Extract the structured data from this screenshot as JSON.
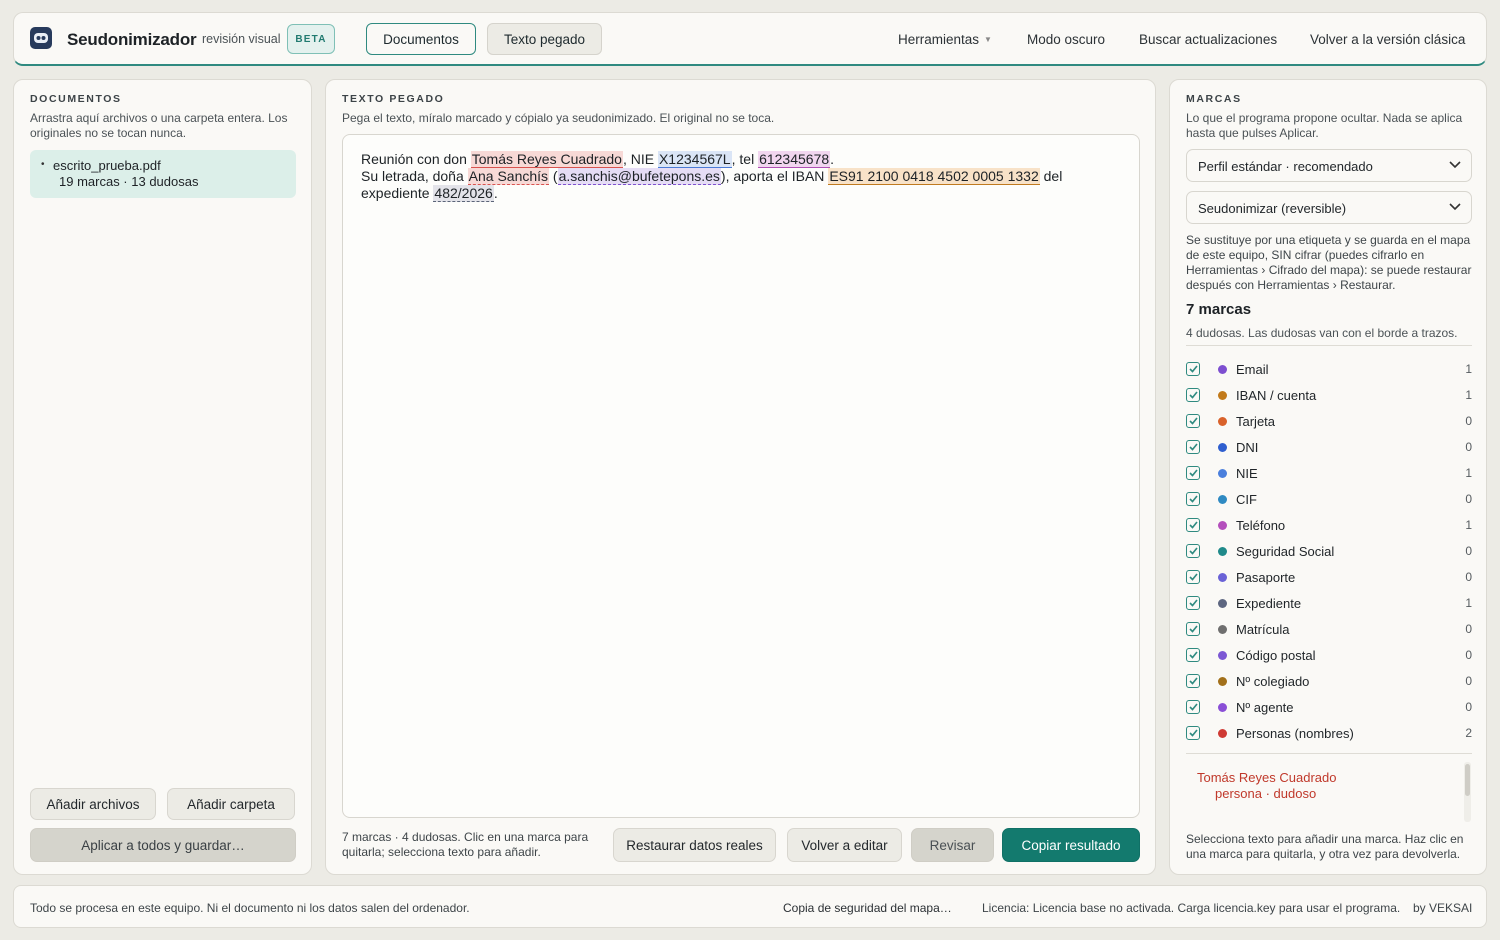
{
  "header": {
    "app_title": "Seudonimizador",
    "subtitle": "revisión visual",
    "badge": "BETA",
    "tabs": [
      {
        "label": "Documentos",
        "active": true
      },
      {
        "label": "Texto pegado",
        "active": false
      }
    ],
    "nav": {
      "tools": "Herramientas",
      "dark_mode": "Modo oscuro",
      "updates": "Buscar actualizaciones",
      "classic": "Volver a la versión clásica"
    }
  },
  "documents": {
    "title": "DOCUMENTOS",
    "description": "Arrastra aquí archivos o una carpeta entera. Los originales no se tocan nunca.",
    "items": [
      {
        "name": "escrito_prueba.pdf",
        "meta": "19 marcas · 13 dudosas"
      }
    ],
    "add_files": "Añadir archivos",
    "add_folder": "Añadir carpeta",
    "apply_all": "Aplicar a todos y guardar…"
  },
  "pasted": {
    "title": "TEXTO PEGADO",
    "description": "Pega el texto, míralo marcado y cópialo ya seudonimizado. El original no se toca.",
    "text": {
      "t1": "Reunión con don ",
      "m1": "Tomás Reyes Cuadrado",
      "t2": ", NIE ",
      "m2": "X1234567L",
      "t3": ", tel ",
      "m3": "612345678",
      "t4": ".",
      "t5": "Su letrada, doña ",
      "m4": "Ana Sanchís",
      "t6": " (",
      "m5": "a.sanchis@bufetepons.es",
      "t7": "), aporta el IBAN ",
      "m6": "ES91 2100 0418 4502 0005 1332",
      "t8": " del expediente ",
      "m7": "482/2026",
      "t9": "."
    },
    "status": "7 marcas · 4 dudosas. Clic en una marca para quitarla; selecciona texto para añadir.",
    "buttons": {
      "restore": "Restaurar datos reales",
      "back": "Volver a editar",
      "review": "Revisar",
      "copy": "Copiar resultado"
    }
  },
  "marks": {
    "title": "MARCAS",
    "description": "Lo que el programa propone ocultar. Nada se aplica hasta que pulses Aplicar.",
    "profile_select": "Perfil estándar · recomendado",
    "mode_select": "Seudonimizar (reversible)",
    "mode_description": "Se sustituye por una etiqueta y se guarda en el mapa de este equipo, SIN cifrar (puedes cifrarlo en Herramientas › Cifrado del mapa): se puede restaurar después con Herramientas › Restaurar.",
    "count_title": "7 marcas",
    "count_description": "4 dudosas. Las dudosas van con el borde a trazos.",
    "categories": [
      {
        "label": "Email",
        "count": "1",
        "color": "#7d4fd0",
        "checked": true
      },
      {
        "label": "IBAN / cuenta",
        "count": "1",
        "color": "#c27a1a",
        "checked": true
      },
      {
        "label": "Tarjeta",
        "count": "0",
        "color": "#d9622b",
        "checked": true
      },
      {
        "label": "DNI",
        "count": "0",
        "color": "#2f5fcf",
        "checked": true
      },
      {
        "label": "NIE",
        "count": "1",
        "color": "#4a7fdc",
        "checked": true
      },
      {
        "label": "CIF",
        "count": "0",
        "color": "#2f8ac2",
        "checked": true
      },
      {
        "label": "Teléfono",
        "count": "1",
        "color": "#b44fbc",
        "checked": true
      },
      {
        "label": "Seguridad Social",
        "count": "0",
        "color": "#1f8a8a",
        "checked": true
      },
      {
        "label": "Pasaporte",
        "count": "0",
        "color": "#6a62d6",
        "checked": true
      },
      {
        "label": "Expediente",
        "count": "1",
        "color": "#5d6680",
        "checked": true
      },
      {
        "label": "Matrícula",
        "count": "0",
        "color": "#6f6f6f",
        "checked": true
      },
      {
        "label": "Código postal",
        "count": "0",
        "color": "#7c58d4",
        "checked": true
      },
      {
        "label": "Nº colegiado",
        "count": "0",
        "color": "#a2701a",
        "checked": true
      },
      {
        "label": "Nº agente",
        "count": "0",
        "color": "#8a4fd6",
        "checked": true
      },
      {
        "label": "Personas (nombres)",
        "count": "2",
        "color": "#cf3a34",
        "checked": true
      }
    ],
    "mark_list": [
      {
        "text": "Tomás Reyes Cuadrado",
        "kind": "persona · dudoso"
      }
    ],
    "hint": "Selecciona texto para añadir una marca. Haz clic en una marca para quitarla, y otra vez para devolverla."
  },
  "footer": {
    "privacy": "Todo se procesa en este equipo. Ni el documento ni los datos salen del ordenador.",
    "backup": "Copia de seguridad del mapa…",
    "license": "Licencia: Licencia base no activada. Carga licencia.key para usar el programa.",
    "by": "by VEKSAI"
  }
}
